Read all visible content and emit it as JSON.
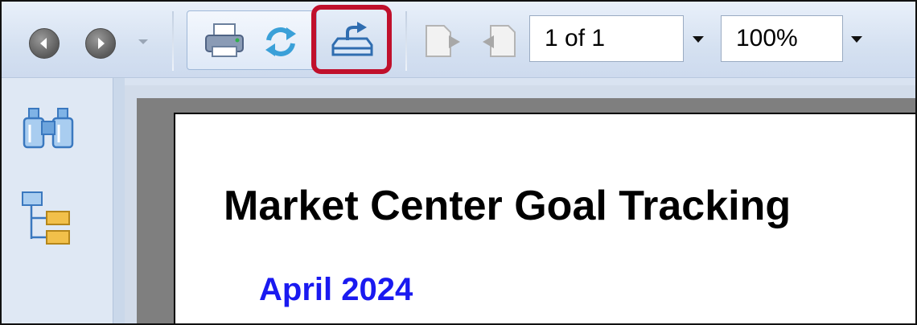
{
  "toolbar": {
    "back_icon": "back-arrow-icon",
    "forward_icon": "forward-arrow-icon",
    "history_dropdown_icon": "chevron-down-icon",
    "print_icon": "printer-icon",
    "refresh_icon": "refresh-icon",
    "export_icon": "export-icon",
    "export_highlight_color": "#c0102c",
    "prev_page_icon": "previous-page-icon",
    "next_page_icon": "next-page-icon",
    "page_selector": {
      "value": "1 of 1"
    },
    "zoom_selector": {
      "value": "100%"
    }
  },
  "sidebar": {
    "items": [
      {
        "icon": "binoculars-icon"
      },
      {
        "icon": "document-map-icon"
      }
    ]
  },
  "report": {
    "title": "Market Center Goal Tracking",
    "subtitle": "April 2024",
    "subtitle_color": "#1a1af0"
  }
}
